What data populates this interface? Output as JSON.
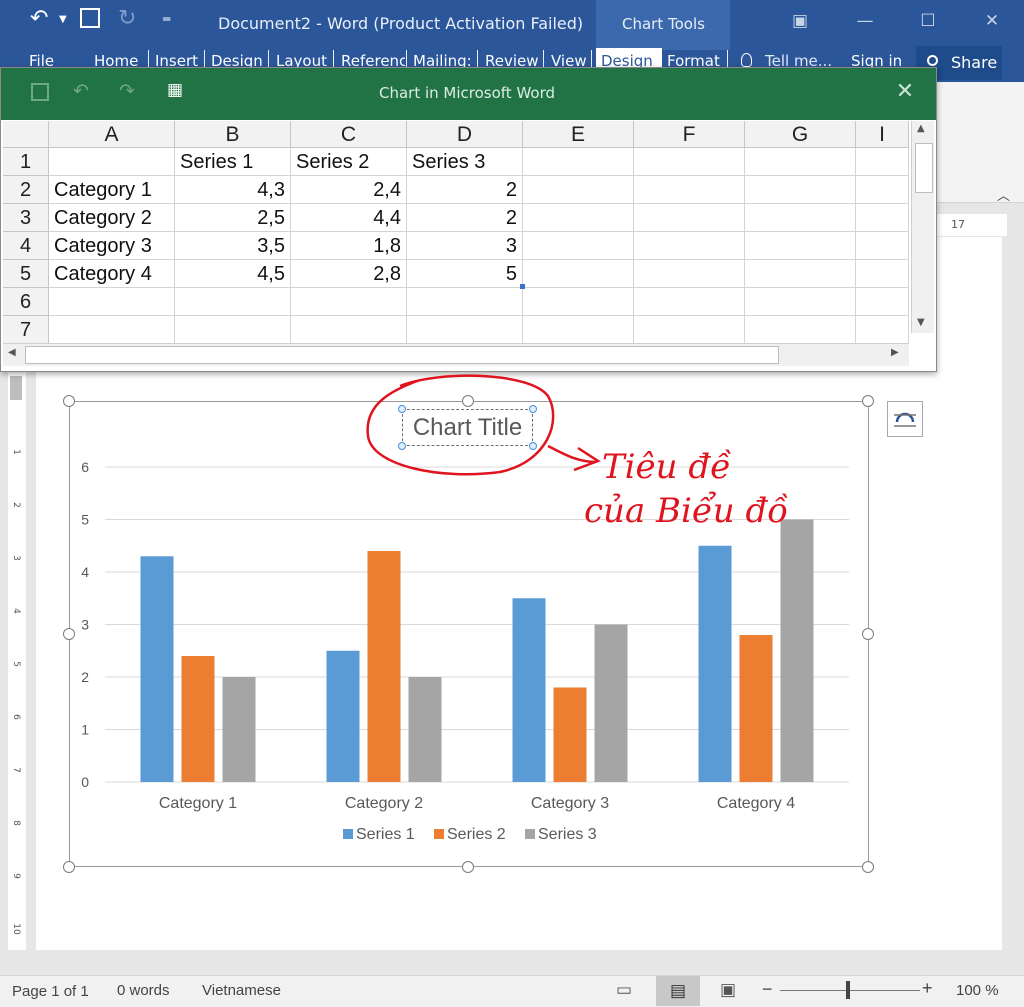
{
  "word": {
    "title": "Document2 - Word (Product Activation Failed)",
    "chart_tools_label": "Chart Tools",
    "tabs": [
      "File",
      "Home",
      "Insert",
      "Design",
      "Layout",
      "Referenc",
      "Mailing:",
      "Review",
      "View",
      "Design",
      "Format"
    ],
    "tell_me": "Tell me...",
    "sign_in": "Sign in",
    "share": "Share",
    "ruler_mark": "17"
  },
  "sheet": {
    "title": "Chart in Microsoft Word",
    "columns": [
      "A",
      "B",
      "C",
      "D",
      "E",
      "F",
      "G",
      "I"
    ],
    "rows": [
      {
        "num": "1",
        "cells": [
          "",
          "Series 1",
          "Series 2",
          "Series 3"
        ]
      },
      {
        "num": "2",
        "cells": [
          "Category 1",
          "4,3",
          "2,4",
          "2"
        ]
      },
      {
        "num": "3",
        "cells": [
          "Category 2",
          "2,5",
          "4,4",
          "2"
        ]
      },
      {
        "num": "4",
        "cells": [
          "Category 3",
          "3,5",
          "1,8",
          "3"
        ]
      },
      {
        "num": "5",
        "cells": [
          "Category 4",
          "4,5",
          "2,8",
          "5"
        ]
      },
      {
        "num": "6",
        "cells": [
          "",
          "",
          "",
          ""
        ]
      },
      {
        "num": "7",
        "cells": [
          "",
          "",
          "",
          ""
        ]
      }
    ]
  },
  "chart_data": {
    "type": "bar",
    "title": "Chart Title",
    "categories": [
      "Category 1",
      "Category 2",
      "Category 3",
      "Category 4"
    ],
    "series": [
      {
        "name": "Series 1",
        "values": [
          4.3,
          2.5,
          3.5,
          4.5
        ],
        "color": "#5b9bd5"
      },
      {
        "name": "Series 2",
        "values": [
          2.4,
          4.4,
          1.8,
          2.8
        ],
        "color": "#ed7d31"
      },
      {
        "name": "Series 3",
        "values": [
          2,
          2,
          3,
          5
        ],
        "color": "#a5a5a5"
      }
    ],
    "ylim": [
      0,
      6
    ],
    "yticks": [
      "0",
      "1",
      "2",
      "3",
      "4",
      "5",
      "6"
    ],
    "grid": true,
    "legend": "bottom"
  },
  "annotation": {
    "line1": "Tiêu đề",
    "line2": "của Biểu đồ",
    "color": "#e0141e"
  },
  "status": {
    "page": "Page 1 of 1",
    "words": "0 words",
    "language": "Vietnamese",
    "zoom": "100 %"
  }
}
